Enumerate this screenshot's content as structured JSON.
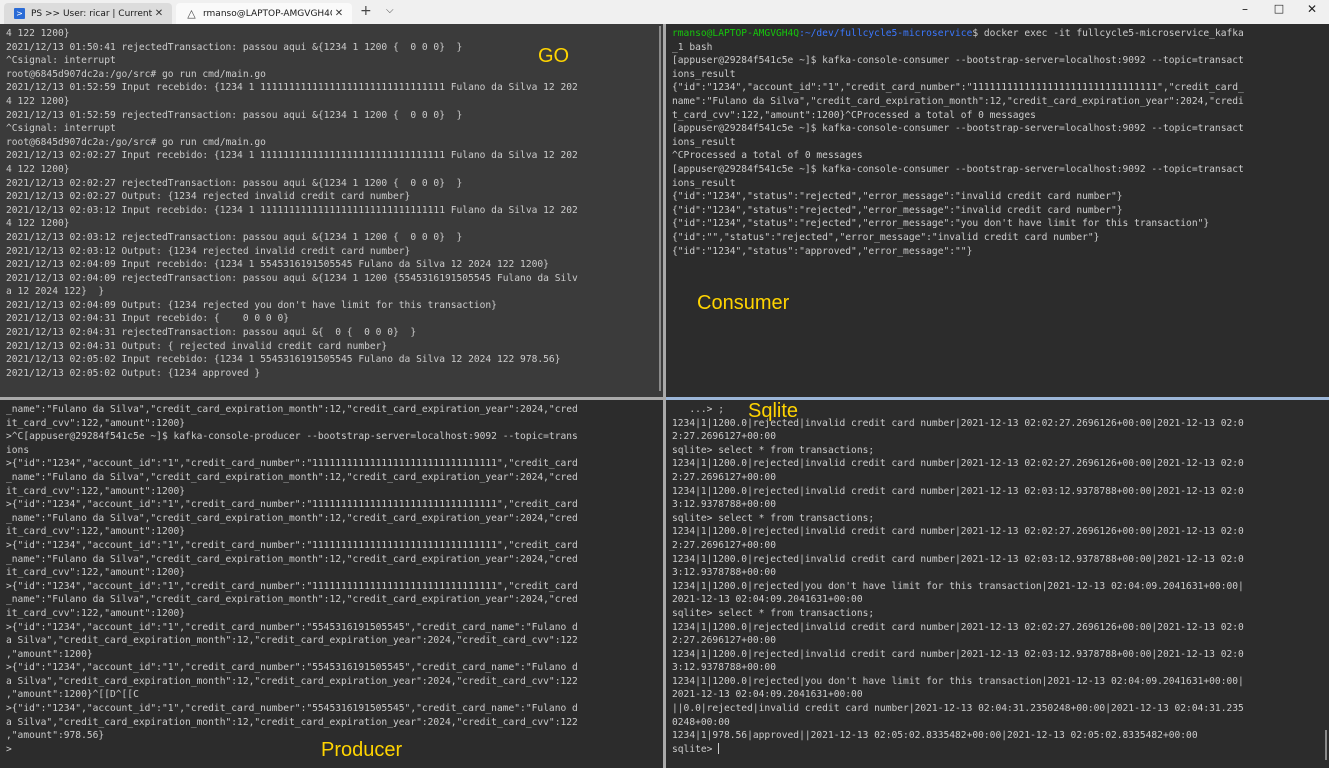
{
  "tabs": [
    {
      "label": "PS >> User: ricar | Current DIR: ",
      "icon": "powershell-icon"
    },
    {
      "label": "rmanso@LAPTOP-AMGVGH4Q: ",
      "icon": "linux-penguin-icon"
    }
  ],
  "window_controls": {
    "minimize": "–",
    "maximize": "□",
    "close": "✕"
  },
  "new_tab": "+",
  "dropdown": "⌵",
  "labels": {
    "go": "GO",
    "consumer": "Consumer",
    "producer": "Producer",
    "sqlite": "Sqlite"
  },
  "panes": {
    "go": [
      "4 122 1200}",
      "2021/12/13 01:50:41 rejectedTransaction: passou aqui &{1234 1 1200 {  0 0 0}  }",
      "^Csignal: interrupt",
      "root@6845d907dc2a:/go/src# go run cmd/main.go",
      "2021/12/13 01:52:59 Input recebido: {1234 1 11111111111111111111111111111111 Fulano da Silva 12 202",
      "4 122 1200}",
      "2021/12/13 01:52:59 rejectedTransaction: passou aqui &{1234 1 1200 {  0 0 0}  }",
      "^Csignal: interrupt",
      "root@6845d907dc2a:/go/src# go run cmd/main.go",
      "2021/12/13 02:02:27 Input recebido: {1234 1 11111111111111111111111111111111 Fulano da Silva 12 202",
      "4 122 1200}",
      "2021/12/13 02:02:27 rejectedTransaction: passou aqui &{1234 1 1200 {  0 0 0}  }",
      "2021/12/13 02:02:27 Output: {1234 rejected invalid credit card number}",
      "2021/12/13 02:03:12 Input recebido: {1234 1 11111111111111111111111111111111 Fulano da Silva 12 202",
      "4 122 1200}",
      "2021/12/13 02:03:12 rejectedTransaction: passou aqui &{1234 1 1200 {  0 0 0}  }",
      "2021/12/13 02:03:12 Output: {1234 rejected invalid credit card number}",
      "2021/12/13 02:04:09 Input recebido: {1234 1 5545316191505545 Fulano da Silva 12 2024 122 1200}",
      "2021/12/13 02:04:09 rejectedTransaction: passou aqui &{1234 1 1200 {5545316191505545 Fulano da Silv",
      "a 12 2024 122}  }",
      "2021/12/13 02:04:09 Output: {1234 rejected you don't have limit for this transaction}",
      "2021/12/13 02:04:31 Input recebido: {    0 0 0 0}",
      "2021/12/13 02:04:31 rejectedTransaction: passou aqui &{  0 {  0 0 0}  }",
      "2021/12/13 02:04:31 Output: { rejected invalid credit card number}",
      "2021/12/13 02:05:02 Input recebido: {1234 1 5545316191505545 Fulano da Silva 12 2024 122 978.56}",
      "2021/12/13 02:05:02 Output: {1234 approved }"
    ],
    "consumer": {
      "prompt_user": "rmanso@LAPTOP-AMGVGH4Q",
      "prompt_path": ":~/dev/fullcycle5-microservice",
      "prompt_cmd": "$ docker exec -it fullcycle5-microservice_kafka",
      "lines": [
        "_1 bash",
        "[appuser@29284f541c5e ~]$ kafka-console-consumer --bootstrap-server=localhost:9092 --topic=transact",
        "ions_result",
        "{\"id\":\"1234\",\"account_id\":\"1\",\"credit_card_number\":\"11111111111111111111111111111111\",\"credit_card_",
        "name\":\"Fulano da Silva\",\"credit_card_expiration_month\":12,\"credit_card_expiration_year\":2024,\"credi",
        "t_card_cvv\":122,\"amount\":1200}^CProcessed a total of 0 messages",
        "[appuser@29284f541c5e ~]$ kafka-console-consumer --bootstrap-server=localhost:9092 --topic=transact",
        "ions_result",
        "^CProcessed a total of 0 messages",
        "[appuser@29284f541c5e ~]$ kafka-console-consumer --bootstrap-server=localhost:9092 --topic=transact",
        "ions_result",
        "{\"id\":\"1234\",\"status\":\"rejected\",\"error_message\":\"invalid credit card number\"}",
        "{\"id\":\"1234\",\"status\":\"rejected\",\"error_message\":\"invalid credit card number\"}",
        "{\"id\":\"1234\",\"status\":\"rejected\",\"error_message\":\"you don't have limit for this transaction\"}",
        "{\"id\":\"\",\"status\":\"rejected\",\"error_message\":\"invalid credit card number\"}",
        "{\"id\":\"1234\",\"status\":\"approved\",\"error_message\":\"\"}"
      ]
    },
    "producer": [
      "_name\":\"Fulano da Silva\",\"credit_card_expiration_month\":12,\"credit_card_expiration_year\":2024,\"cred",
      "it_card_cvv\":122,\"amount\":1200}",
      ">^C[appuser@29284f541c5e ~]$ kafka-console-producer --bootstrap-server=localhost:9092 --topic=trans",
      "ions",
      ">{\"id\":\"1234\",\"account_id\":\"1\",\"credit_card_number\":\"11111111111111111111111111111111\",\"credit_card",
      "_name\":\"Fulano da Silva\",\"credit_card_expiration_month\":12,\"credit_card_expiration_year\":2024,\"cred",
      "it_card_cvv\":122,\"amount\":1200}",
      ">{\"id\":\"1234\",\"account_id\":\"1\",\"credit_card_number\":\"11111111111111111111111111111111\",\"credit_card",
      "_name\":\"Fulano da Silva\",\"credit_card_expiration_month\":12,\"credit_card_expiration_year\":2024,\"cred",
      "it_card_cvv\":122,\"amount\":1200}",
      ">{\"id\":\"1234\",\"account_id\":\"1\",\"credit_card_number\":\"11111111111111111111111111111111\",\"credit_card",
      "_name\":\"Fulano da Silva\",\"credit_card_expiration_month\":12,\"credit_card_expiration_year\":2024,\"cred",
      "it_card_cvv\":122,\"amount\":1200}",
      ">{\"id\":\"1234\",\"account_id\":\"1\",\"credit_card_number\":\"11111111111111111111111111111111\",\"credit_card",
      "_name\":\"Fulano da Silva\",\"credit_card_expiration_month\":12,\"credit_card_expiration_year\":2024,\"cred",
      "it_card_cvv\":122,\"amount\":1200}",
      ">{\"id\":\"1234\",\"account_id\":\"1\",\"credit_card_number\":\"5545316191505545\",\"credit_card_name\":\"Fulano d",
      "a Silva\",\"credit_card_expiration_month\":12,\"credit_card_expiration_year\":2024,\"credit_card_cvv\":122",
      ",\"amount\":1200}",
      ">{\"id\":\"1234\",\"account_id\":\"1\",\"credit_card_number\":\"5545316191505545\",\"credit_card_name\":\"Fulano d",
      "a Silva\",\"credit_card_expiration_month\":12,\"credit_card_expiration_year\":2024,\"credit_card_cvv\":122",
      ",\"amount\":1200}^[[D^[[C",
      ">{\"id\":\"1234\",\"account_id\":\"1\",\"credit_card_number\":\"5545316191505545\",\"credit_card_name\":\"Fulano d",
      "a Silva\",\"credit_card_expiration_month\":12,\"credit_card_expiration_year\":2024,\"credit_card_cvv\":122",
      ",\"amount\":978.56}",
      ">"
    ],
    "sqlite": [
      "   ...> ;",
      "1234|1|1200.0|rejected|invalid credit card number|2021-12-13 02:02:27.2696126+00:00|2021-12-13 02:0",
      "2:27.2696127+00:00",
      "sqlite> select * from transactions;",
      "1234|1|1200.0|rejected|invalid credit card number|2021-12-13 02:02:27.2696126+00:00|2021-12-13 02:0",
      "2:27.2696127+00:00",
      "1234|1|1200.0|rejected|invalid credit card number|2021-12-13 02:03:12.9378788+00:00|2021-12-13 02:0",
      "3:12.9378788+00:00",
      "sqlite> select * from transactions;",
      "1234|1|1200.0|rejected|invalid credit card number|2021-12-13 02:02:27.2696126+00:00|2021-12-13 02:0",
      "2:27.2696127+00:00",
      "1234|1|1200.0|rejected|invalid credit card number|2021-12-13 02:03:12.9378788+00:00|2021-12-13 02:0",
      "3:12.9378788+00:00",
      "1234|1|1200.0|rejected|you don't have limit for this transaction|2021-12-13 02:04:09.2041631+00:00|",
      "2021-12-13 02:04:09.2041631+00:00",
      "sqlite> select * from transactions;",
      "1234|1|1200.0|rejected|invalid credit card number|2021-12-13 02:02:27.2696126+00:00|2021-12-13 02:0",
      "2:27.2696127+00:00",
      "1234|1|1200.0|rejected|invalid credit card number|2021-12-13 02:03:12.9378788+00:00|2021-12-13 02:0",
      "3:12.9378788+00:00",
      "1234|1|1200.0|rejected|you don't have limit for this transaction|2021-12-13 02:04:09.2041631+00:00|",
      "2021-12-13 02:04:09.2041631+00:00",
      "||0.0|rejected|invalid credit card number|2021-12-13 02:04:31.2350248+00:00|2021-12-13 02:04:31.235",
      "0248+00:00",
      "1234|1|978.56|approved||2021-12-13 02:05:02.8335482+00:00|2021-12-13 02:05:02.8335482+00:00",
      "sqlite> "
    ]
  }
}
